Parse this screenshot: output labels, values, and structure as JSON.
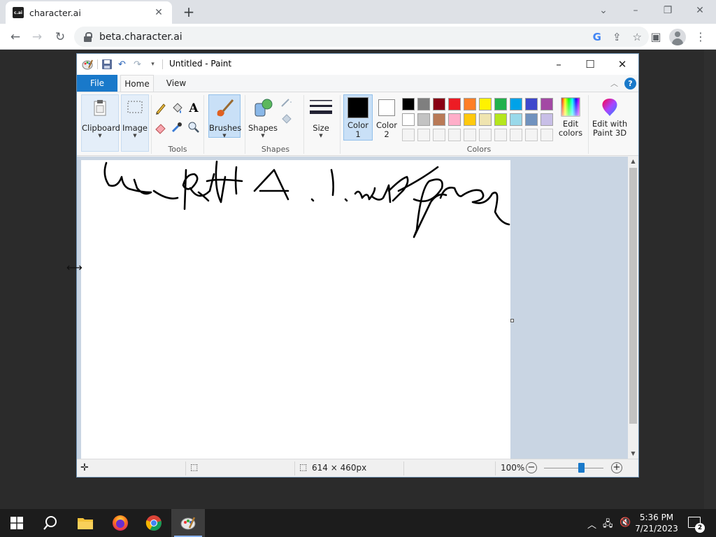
{
  "browser": {
    "tab_favicon_text": "c.ai",
    "tab_title": "character.ai",
    "url": "beta.character.ai",
    "icons": [
      "new-tab-icon",
      "back-icon",
      "forward-icon",
      "reload-icon",
      "lock-icon",
      "google-lens-icon",
      "share-icon",
      "bookmark-star-icon",
      "side-panel-icon",
      "profile-icon",
      "menu-icon"
    ]
  },
  "paint": {
    "title": "Untitled - Paint",
    "tabs": {
      "file": "File",
      "home": "Home",
      "view": "View"
    },
    "groups": {
      "clipboard": "Clipboard",
      "image": "Image",
      "tools": "Tools",
      "brushes": "Brushes",
      "shapes": "Shapes",
      "shapes_group": "Shapes",
      "size": "Size",
      "color1_line1": "Color",
      "color1_line2": "1",
      "color2_line1": "Color",
      "color2_line2": "2",
      "colors": "Colors",
      "edit_colors_line1": "Edit",
      "edit_colors_line2": "colors",
      "paint3d_line1": "Edit with",
      "paint3d_line2": "Paint 3D"
    },
    "palette_row1": [
      "#000000",
      "#7f7f7f",
      "#880015",
      "#ed1c24",
      "#ff7f27",
      "#fff200",
      "#22b14c",
      "#00a2e8",
      "#3f48cc",
      "#a349a4"
    ],
    "palette_row2": [
      "#ffffff",
      "#c3c3c3",
      "#b97a57",
      "#ffaec9",
      "#ffc90e",
      "#efe4b0",
      "#b5e61d",
      "#99d9ea",
      "#7092be",
      "#c8bfe7"
    ],
    "color1": "#000000",
    "color2": "#ffffff",
    "status": {
      "dimensions": "614 × 460px",
      "zoom": "100%",
      "zoom_level_percent": 100
    }
  },
  "taskbar": {
    "time": "5:36 PM",
    "date": "7/21/2023",
    "notification_count": "2",
    "apps": [
      "windows-start-icon",
      "search-icon",
      "file-explorer-icon",
      "firefox-icon",
      "chrome-icon",
      "paint-icon"
    ]
  }
}
